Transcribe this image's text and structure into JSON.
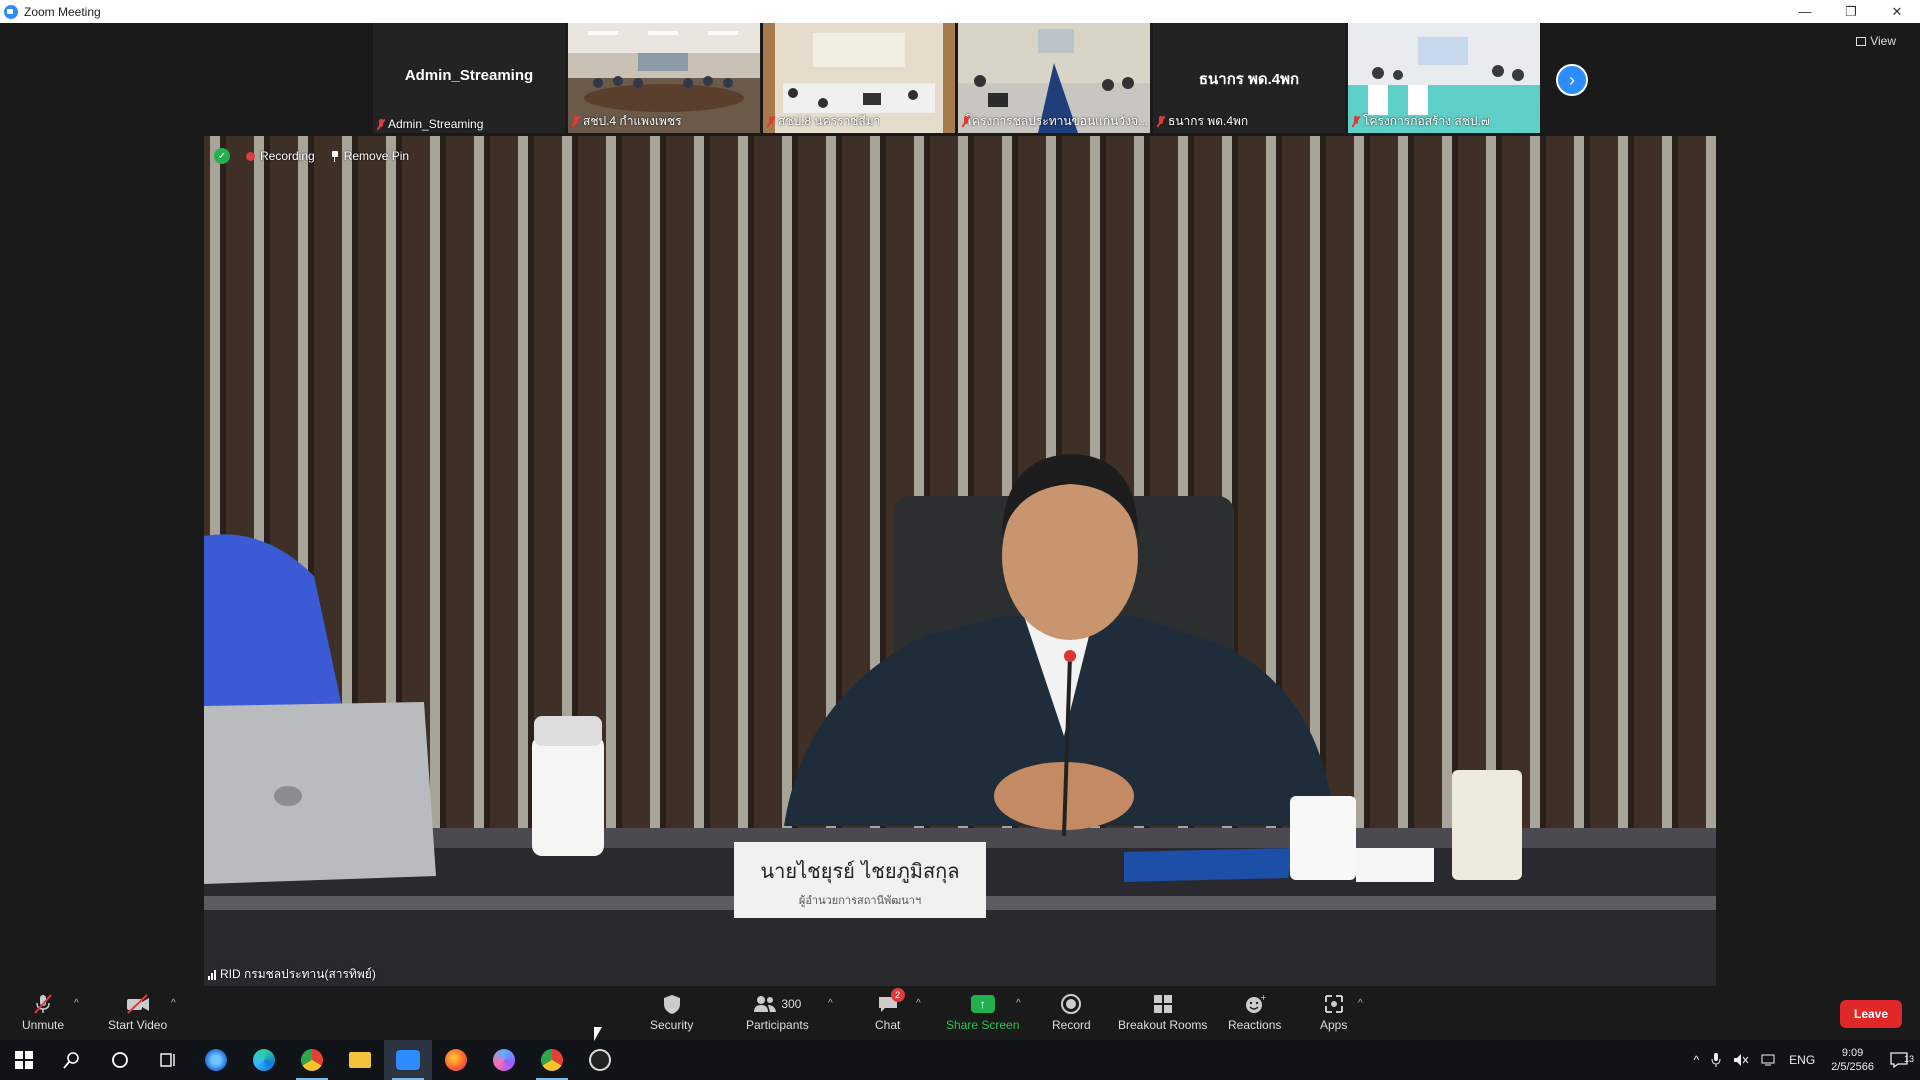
{
  "window": {
    "title": "Zoom Meeting",
    "controls": [
      "—",
      "❐",
      "✕"
    ]
  },
  "strip": {
    "tiles": [
      {
        "name": "Admin_Streaming",
        "label": "Admin_Streaming",
        "video": false
      },
      {
        "name": "",
        "label": "สชป.4 กำแพงเพชร",
        "video": true
      },
      {
        "name": "",
        "label": "สชป.8 นครราชสีมา",
        "video": true
      },
      {
        "name": "",
        "label": "โครงการชลประทานขอนแก่นวังจ...",
        "video": true
      },
      {
        "name": "ธนากร พด.4พก",
        "label": "ธนากร พด.4พก",
        "video": false
      },
      {
        "name": "",
        "label": "โครงการก่อสร้าง สชป.๗",
        "video": true
      }
    ],
    "next_icon": "chevron-right-icon",
    "view_label": "View"
  },
  "main": {
    "recording_label": "Recording",
    "remove_pin_label": "Remove Pin",
    "participant_name": "RID กรมชลประทาน(สารทิพย์)",
    "nameplate_line1": "นายไชยุรย์  ไชยภูมิสกุล",
    "nameplate_line2": "ผู้อำนวยการสถานีพัฒนาฯ"
  },
  "toolbar": {
    "unmute": "Unmute",
    "start_video": "Start Video",
    "security": "Security",
    "participants": "Participants",
    "participants_count": "300",
    "chat": "Chat",
    "chat_badge": "2",
    "share_screen": "Share Screen",
    "record": "Record",
    "breakout_rooms": "Breakout Rooms",
    "reactions": "Reactions",
    "apps": "Apps",
    "leave": "Leave"
  },
  "taskbar": {
    "language": "ENG",
    "time": "9:09",
    "date": "2/5/2566",
    "notifications": "13"
  },
  "colors": {
    "zoom_blue": "#2d8cff",
    "leave_red": "#e02828",
    "share_green": "#23b14d"
  }
}
